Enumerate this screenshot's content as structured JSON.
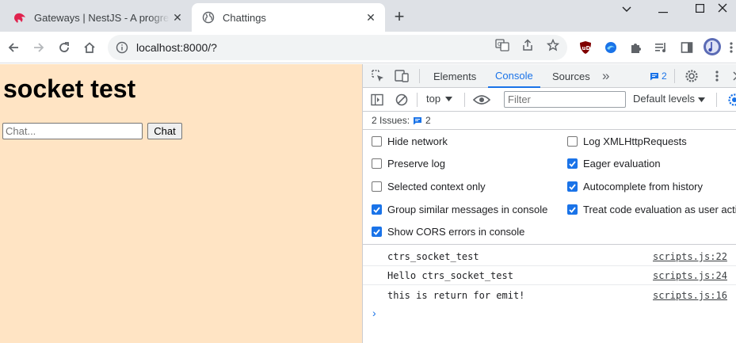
{
  "browser": {
    "tabs": [
      {
        "title": "Gateways | NestJS - A progressive Node.js framework",
        "active": false
      },
      {
        "title": "Chattings",
        "active": true
      }
    ],
    "new_tab_glyph": "+",
    "close_glyph": "✕",
    "address": "localhost:8000/?",
    "extensions": [
      "ublock-origin-icon",
      "edge-icon",
      "puzzle-extensions-icon",
      "media-control-icon",
      "side-panel-icon",
      "profile-avatar"
    ]
  },
  "page": {
    "heading": "socket test",
    "chat_input_placeholder": "Chat...",
    "chat_button_label": "Chat",
    "background_color": "#ffe4c4"
  },
  "devtools": {
    "tabs": [
      "Elements",
      "Console",
      "Sources"
    ],
    "active_tab": "Console",
    "more_tabs_glyph": "»",
    "issues_badge_count": "2",
    "context": "top",
    "filter_placeholder": "Filter",
    "levels": "Default levels",
    "issues_label": "2 Issues:",
    "issues_count": "2",
    "settings": [
      {
        "label": "Hide network",
        "checked": false
      },
      {
        "label": "Log XMLHttpRequests",
        "checked": false
      },
      {
        "label": "Preserve log",
        "checked": false
      },
      {
        "label": "Eager evaluation",
        "checked": true
      },
      {
        "label": "Selected context only",
        "checked": false
      },
      {
        "label": "Autocomplete from history",
        "checked": true
      },
      {
        "label": "Group similar messages in console",
        "checked": true
      },
      {
        "label": "Treat code evaluation as user action",
        "checked": true
      },
      {
        "label": "Show CORS errors in console",
        "checked": true
      }
    ],
    "messages": [
      {
        "text": "ctrs_socket_test",
        "source": "scripts.js:22"
      },
      {
        "text": "Hello ctrs_socket_test",
        "source": "scripts.js:24"
      },
      {
        "text": "this is return for emit!",
        "source": "scripts.js:16"
      }
    ],
    "prompt_glyph": "›"
  }
}
